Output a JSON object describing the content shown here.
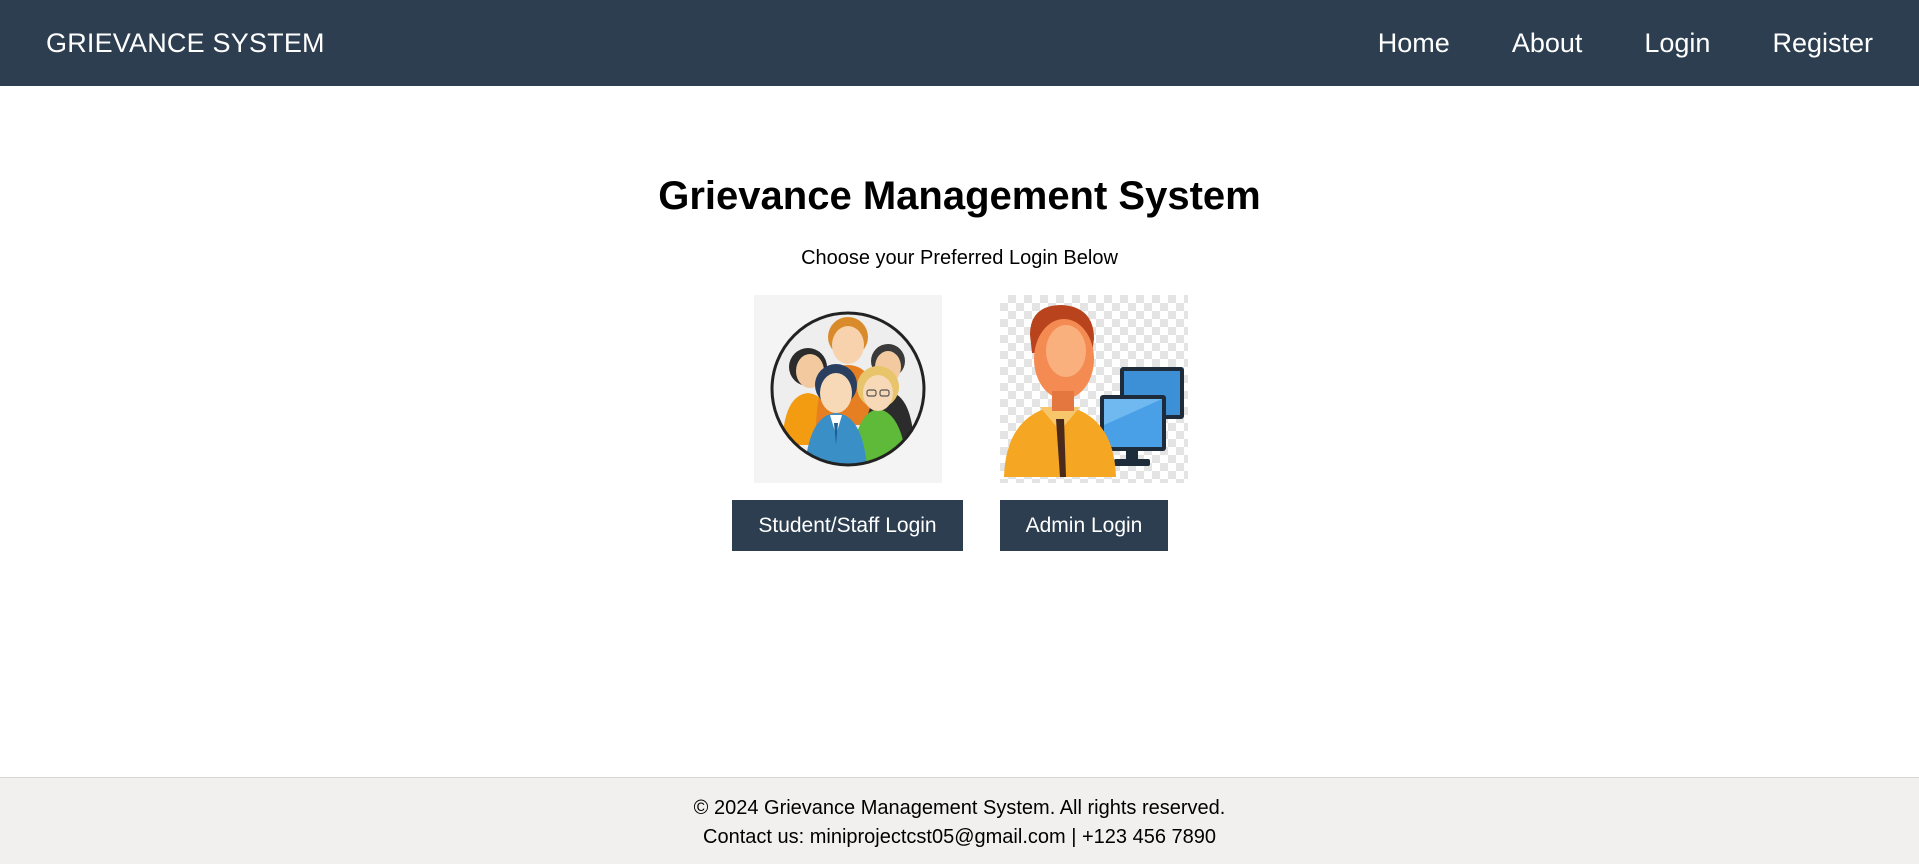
{
  "navbar": {
    "brand": "GRIEVANCE SYSTEM",
    "links": [
      "Home",
      "About",
      "Login",
      "Register"
    ],
    "background": "#2c3e50"
  },
  "main": {
    "title": "Grievance Management System",
    "subtitle": "Choose your Preferred Login Below",
    "options": [
      {
        "icon": "user-group-icon",
        "button_label": "Student/Staff Login"
      },
      {
        "icon": "admin-computer-icon",
        "button_label": "Admin Login"
      }
    ]
  },
  "footer": {
    "copyright": "© 2024 Grievance Management System. All rights reserved.",
    "contact": "Contact us: miniprojectcst05@gmail.com | +123 456 7890"
  }
}
